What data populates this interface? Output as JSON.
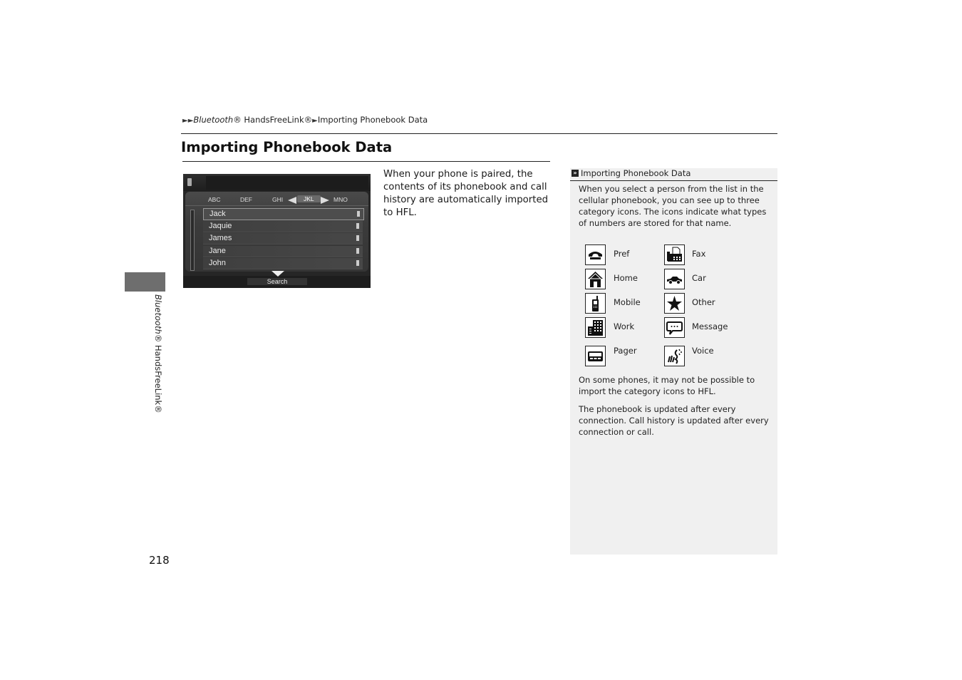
{
  "breadcrumb": {
    "arrows": "►►",
    "section_italic": "Bluetooth",
    "section_rest": "® HandsFreeLink®",
    "sep": "►",
    "current": "Importing Phonebook Data"
  },
  "page_title": "Importing Phonebook Data",
  "side_tab": {
    "italic": "Bluetooth",
    "rest": "® HandsFreeLink®"
  },
  "page_number": "218",
  "screen": {
    "tabs": [
      "ABC",
      "DEF",
      "GHI",
      "JKL",
      "MNO"
    ],
    "active_tab": "JKL",
    "contacts": [
      {
        "name": "Jack",
        "selected": true
      },
      {
        "name": "Jaquie",
        "selected": false
      },
      {
        "name": "James",
        "selected": false
      },
      {
        "name": "Jane",
        "selected": false
      },
      {
        "name": "John",
        "selected": false
      }
    ],
    "search_label": "Search"
  },
  "intro_text": "When your phone is paired, the contents of its phonebook and call history are automatically imported to HFL.",
  "note": {
    "icon": "»",
    "title": "Importing Phonebook Data",
    "paragraph1": "When you select a person from the list in the cellular phonebook, you can see up to three category icons. The icons indicate what types of numbers are stored for that name.",
    "categories": [
      {
        "label": "Pref",
        "icon": "phone-handset-icon"
      },
      {
        "label": "Fax",
        "icon": "fax-icon"
      },
      {
        "label": "Home",
        "icon": "house-icon"
      },
      {
        "label": "Car",
        "icon": "car-icon"
      },
      {
        "label": "Mobile",
        "icon": "mobile-phone-icon"
      },
      {
        "label": "Other",
        "icon": "star-icon"
      },
      {
        "label": "Work",
        "icon": "building-icon"
      },
      {
        "label": "Message",
        "icon": "speech-bubble-icon"
      },
      {
        "label": "Pager",
        "icon": "pager-icon"
      },
      {
        "label": "Voice",
        "icon": "voice-icon"
      }
    ],
    "paragraph2": "On some phones, it may not be possible to import the category icons to HFL.",
    "paragraph3": "The phonebook is updated after every connection. Call history is updated after every connection or call."
  }
}
